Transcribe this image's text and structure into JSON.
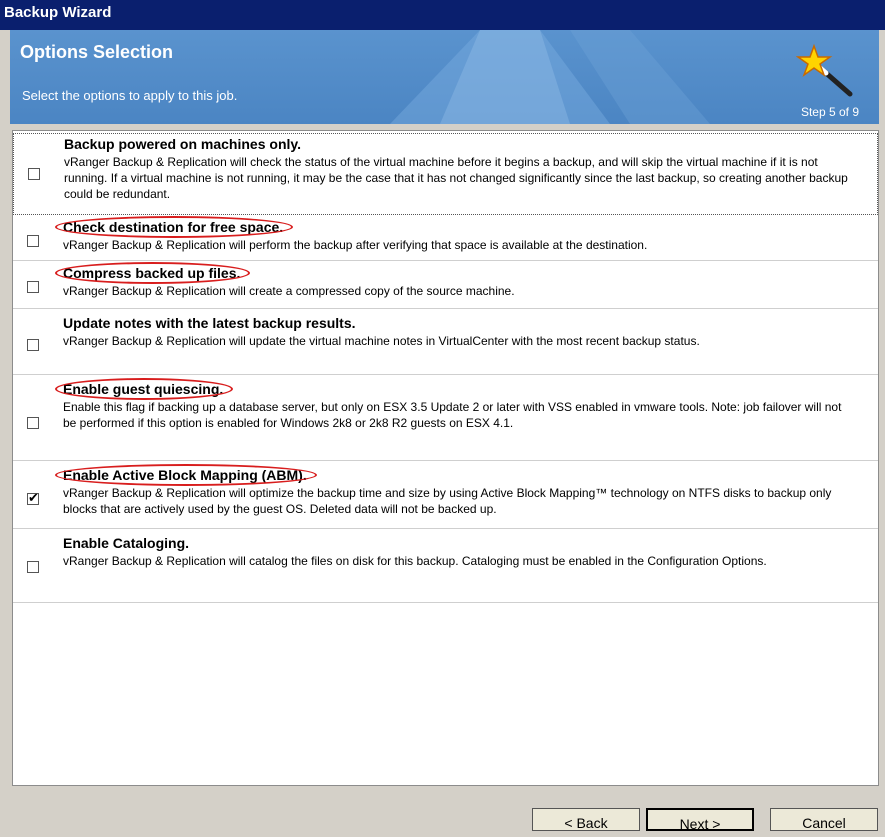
{
  "window": {
    "title": "Backup Wizard"
  },
  "header": {
    "title": "Options Selection",
    "subtitle": "Select the options to apply to this job.",
    "step": "Step 5 of 9"
  },
  "options": [
    {
      "title": "Backup powered on machines only.",
      "desc": "vRanger Backup & Replication will check the status of the virtual machine before it begins a backup, and will skip the virtual machine if it is not running. If a virtual machine is not running, it may be the case that it has not changed significantly since the last backup, so creating another backup could be redundant.",
      "checked": false
    },
    {
      "title": "Check destination for free space.",
      "desc": "vRanger Backup & Replication will perform the backup after verifying that space is available at the destination.",
      "checked": false
    },
    {
      "title": "Compress backed up files.",
      "desc": "vRanger Backup & Replication will create a compressed copy of the source machine.",
      "checked": false
    },
    {
      "title": "Update notes with the latest backup results.",
      "desc": "vRanger Backup & Replication will update the virtual machine notes in VirtualCenter with the most recent backup status.",
      "checked": false
    },
    {
      "title": "Enable guest quiescing.",
      "desc": "Enable this flag if backing up a database server, but only on ESX 3.5 Update 2 or later with VSS enabled in vmware tools. Note: job failover will not be performed if this option is enabled for Windows 2k8 or 2k8 R2 guests on ESX 4.1.",
      "checked": false
    },
    {
      "title": "Enable Active Block Mapping (ABM).",
      "desc": "vRanger Backup & Replication will optimize the backup time and size by using Active Block Mapping™ technology on NTFS disks to backup only blocks that are actively used by the guest OS. Deleted data will not be backed up.",
      "checked": true
    },
    {
      "title": "Enable Cataloging.",
      "desc": "vRanger Backup & Replication will catalog the files on disk for this backup. Cataloging must be enabled in the Configuration Options.",
      "checked": false
    }
  ],
  "buttons": {
    "back": "< Back",
    "next": "Next >",
    "cancel": "Cancel"
  },
  "icons": {
    "wizard": "magic-wand-icon"
  }
}
